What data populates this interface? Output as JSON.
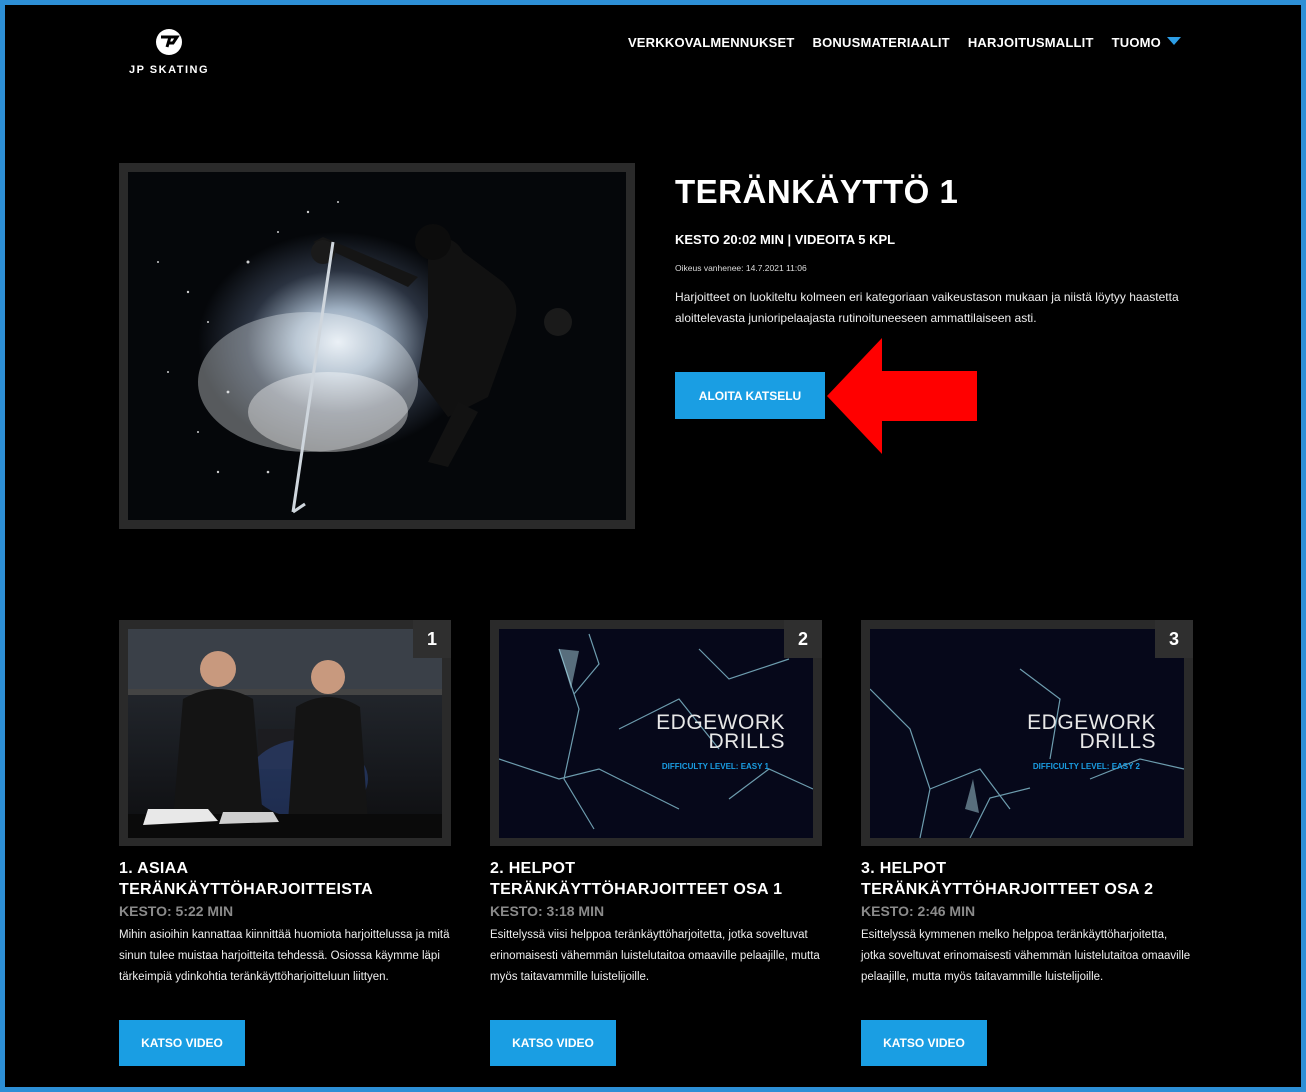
{
  "brand": {
    "name": "JP SKATING"
  },
  "nav": {
    "items": [
      "VERKKOVALMENNUKSET",
      "BONUSMATERIAALIT",
      "HARJOITUSMALLIT",
      "TUOMO"
    ]
  },
  "hero": {
    "title": "TERÄNKÄYTTÖ 1",
    "meta": "KESTO 20:02 MIN | VIDEOITA 5 KPL",
    "expiry": "Oikeus vanhenee: 14.7.2021 11:06",
    "description": "Harjoitteet on luokiteltu kolmeen eri kategoriaan vaikeustason mukaan ja niistä löytyy haastetta aloittelevasta junioripelaajasta rutinoituneeseen ammattilaiseen asti.",
    "button": "ALOITA KATSELU"
  },
  "colors": {
    "accent": "#1a9ee3",
    "frame": "#2d8fd6",
    "annotation_arrow": "#ff0000"
  },
  "cards": [
    {
      "num": "1",
      "title_line1": "1. ASIAA",
      "title_line2": "TERÄNKÄYTTÖHARJOITTEISTA",
      "duration": "KESTO: 5:22 MIN",
      "description": "Mihin asioihin kannattaa kiinnittää huomiota harjoittelussa ja mitä sinun tulee muistaa harjoitteita tehdessä. Osiossa käymme läpi tärkeimpiä ydinkohtia teränkäyttöharjoitteluun liittyen.",
      "button": "KATSO VIDEO"
    },
    {
      "num": "2",
      "title_line1": "2. HELPOT",
      "title_line2": "TERÄNKÄYTTÖHARJOITTEET OSA 1",
      "duration": "KESTO: 3:18 MIN",
      "description": "Esittelyssä viisi helppoa teränkäyttöharjoitetta, jotka soveltuvat erinomaisesti vähemmän luistelutaitoa omaaville pelaajille, mutta myös taitavammille luistelijoille.",
      "button": "KATSO VIDEO",
      "thumb_title_1": "EDGEWORK",
      "thumb_title_2": "DRILLS",
      "thumb_sub": "DIFFICULTY LEVEL: EASY 1"
    },
    {
      "num": "3",
      "title_line1": "3. HELPOT",
      "title_line2": "TERÄNKÄYTTÖHARJOITTEET OSA 2",
      "duration": "KESTO: 2:46 MIN",
      "description": "Esittelyssä kymmenen melko helppoa teränkäyttöharjoitetta, jotka soveltuvat erinomaisesti vähemmän luistelutaitoa omaaville pelaajille, mutta myös taitavammille luistelijoille.",
      "button": "KATSO VIDEO",
      "thumb_title_1": "EDGEWORK",
      "thumb_title_2": "DRILLS",
      "thumb_sub": "DIFFICULTY LEVEL: EASY 2"
    }
  ]
}
